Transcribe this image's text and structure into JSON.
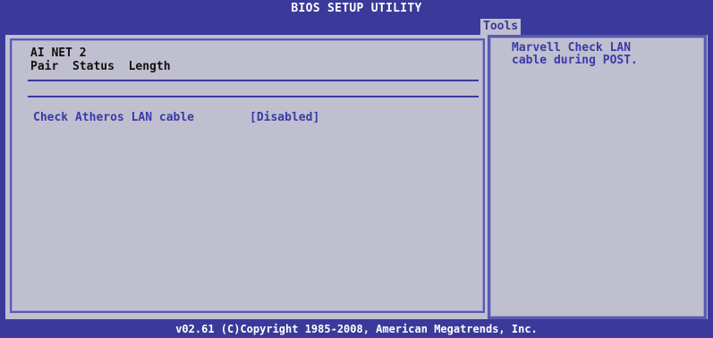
{
  "title": "BIOS SETUP UTILITY",
  "tabs": {
    "active": "Tools"
  },
  "left_panel": {
    "heading_line1": "AI NET 2",
    "heading_line2": "Pair  Status  Length",
    "settings": [
      {
        "label": "Check Atheros LAN cable",
        "value": "[Disabled]"
      }
    ]
  },
  "help_panel": {
    "text": "Marvell Check LAN\ncable during POST."
  },
  "footer": {
    "copyright": "v02.61  (C)Copyright 1985-2008, American Megatrends, Inc."
  },
  "colors": {
    "bios_blue": "#3a3a9a",
    "panel_gray": "#bfbfcf",
    "text_blue": "#3a3aa8"
  }
}
